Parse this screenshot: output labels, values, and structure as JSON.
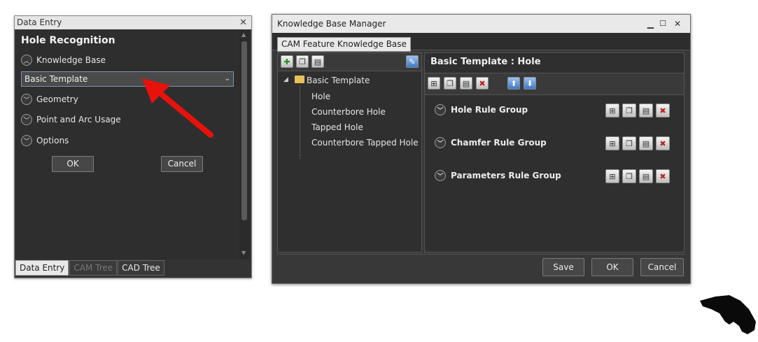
{
  "data_entry": {
    "title": "Data Entry",
    "close_glyph": "✕",
    "heading": "Hole Recognition",
    "knowledge_base_label": "Knowledge Base",
    "template_select": {
      "value": "Basic Template"
    },
    "sections": [
      "Geometry",
      "Point and Arc Usage",
      "Options"
    ],
    "ok_label": "OK",
    "cancel_label": "Cancel",
    "tabs": [
      "Data Entry",
      "CAM Tree",
      "CAD Tree"
    ],
    "active_tab": "Data Entry"
  },
  "knowledge_base_manager": {
    "title": "Knowledge Base Manager",
    "window_controls": [
      "minimize",
      "maximize",
      "close"
    ],
    "tab": "CAM Feature Knowledge Base",
    "tree": {
      "root": "Basic Template",
      "children": [
        "Hole",
        "Counterbore Hole",
        "Tapped Hole",
        "Counterbore Tapped Hole"
      ]
    },
    "detail_title": "Basic Template : Hole",
    "rule_groups": [
      "Hole Rule Group",
      "Chamfer Rule Group",
      "Parameters Rule Group"
    ],
    "buttons": {
      "save": "Save",
      "ok": "OK",
      "cancel": "Cancel"
    }
  },
  "annotation": {
    "arrow_color": "#e8120c",
    "points_to": "template_select"
  },
  "icons": {
    "expander_open": "chevron-up-icon",
    "expander_closed": "chevron-down-icon",
    "folder": "folder-icon",
    "logo": "panther-logo"
  }
}
